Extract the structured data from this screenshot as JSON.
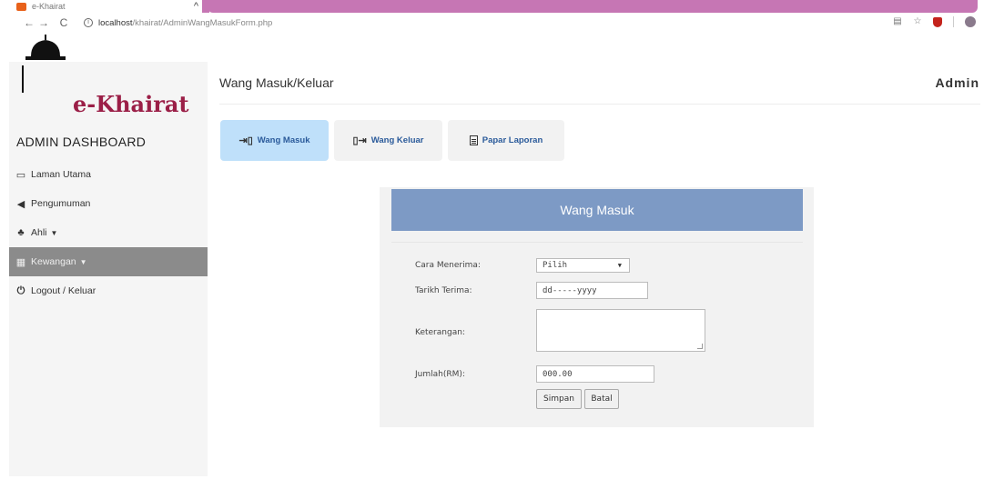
{
  "browser": {
    "tab_title": "e-Khairat",
    "url_host": "localhost",
    "url_path": "/khairat/AdminWangMasukForm.php"
  },
  "brand": {
    "name": "e-Khairat",
    "color": "#9b1f47"
  },
  "sidebar": {
    "title": "ADMIN DASHBOARD",
    "items": [
      {
        "label": "Laman Utama",
        "icon": "monitor-icon"
      },
      {
        "label": "Pengumuman",
        "icon": "bullhorn-icon"
      },
      {
        "label": "Ahli",
        "icon": "users-icon",
        "dropdown": true
      },
      {
        "label": "Kewangan",
        "icon": "money-icon",
        "dropdown": true,
        "active": true
      },
      {
        "label": "Logout / Keluar",
        "icon": "power-icon"
      }
    ]
  },
  "header": {
    "title": "Wang Masuk/Keluar",
    "user": "Admin"
  },
  "tabs": [
    {
      "label": "Wang Masuk",
      "icon": "sign-in-icon",
      "active": true
    },
    {
      "label": "Wang Keluar",
      "icon": "sign-out-icon"
    },
    {
      "label": "Papar Laporan",
      "icon": "document-icon"
    }
  ],
  "form": {
    "heading": "Wang Masuk",
    "fields": {
      "cara_label": "Cara Menerima:",
      "cara_value": "Pilih",
      "tarikh_label": "Tarikh Terima:",
      "tarikh_placeholder": "dd-----yyyy",
      "keterangan_label": "Keterangan:",
      "jumlah_label": "Jumlah(RM):",
      "jumlah_placeholder": "000.00"
    },
    "save_label": "Simpan",
    "cancel_label": "Batal"
  },
  "colors": {
    "header_bar": "#7d9ac5",
    "active_tab": "#bfe0fa",
    "browser_accent": "#c676b4"
  }
}
